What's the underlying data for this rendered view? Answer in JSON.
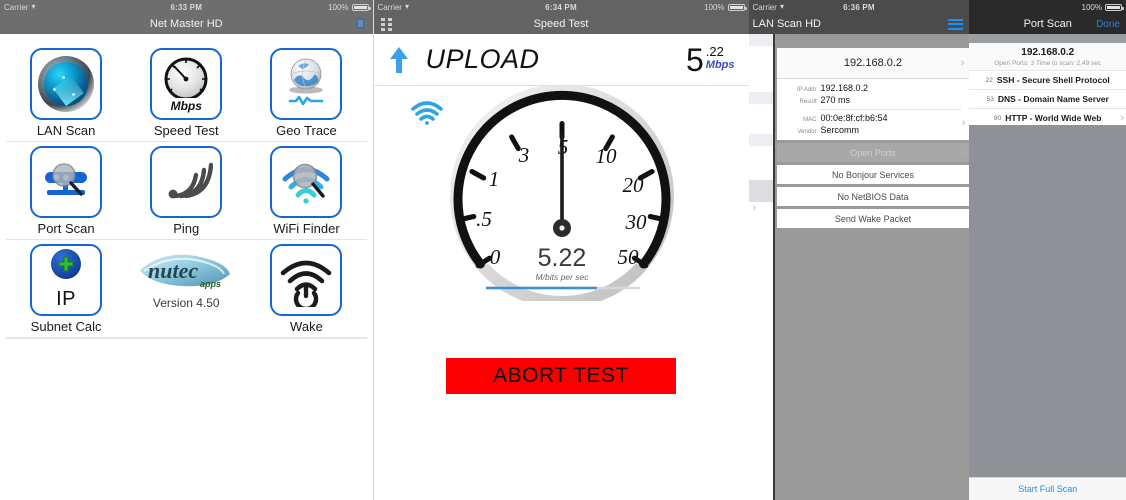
{
  "panels": {
    "net_master": {
      "status": {
        "carrier": "Carrier",
        "wifi_icon": "wifi-icon",
        "time": "6:33 PM",
        "battery_pct": "100%"
      },
      "nav": {
        "title": "Net Master HD",
        "right_icon": "info-icon"
      },
      "rows": [
        [
          {
            "label": "LAN Scan",
            "icon": "radar-orb-icon"
          },
          {
            "label": "Speed Test",
            "icon": "speedometer-icon",
            "inner_text": "Mbps"
          },
          {
            "label": "Geo Trace",
            "icon": "globe-trace-icon"
          }
        ],
        [
          {
            "label": "Port Scan",
            "icon": "magnifier-server-icon"
          },
          {
            "label": "Ping",
            "icon": "ping-waves-icon"
          },
          {
            "label": "WiFi Finder",
            "icon": "wifi-magnifier-icon"
          }
        ],
        [
          {
            "label": "Subnet Calc",
            "icon": "ip-plus-icon",
            "inner_text": "IP"
          },
          {
            "label": "",
            "icon": "nutec-apps-logo",
            "version": "Version 4.50"
          },
          {
            "label": "Wake",
            "icon": "wifi-power-icon"
          }
        ]
      ]
    },
    "speed_test": {
      "status": {
        "carrier": "Carrier",
        "wifi_icon": "wifi-icon",
        "time": "6:34 PM",
        "battery_pct": "100%"
      },
      "nav": {
        "title": "Speed Test",
        "left_icon": "grid-apps-icon"
      },
      "direction": {
        "label": "UPLOAD",
        "icon": "up-arrow-icon"
      },
      "reading": {
        "whole": "5",
        "decimal": ".22",
        "unit": "Mbps"
      },
      "gauge": {
        "center_value": "5.22",
        "center_unit": "M/bits per sec",
        "wifi_icon": "wifi-signal-icon"
      },
      "abort_label": "ABORT TEST",
      "accent": "#fb0000"
    },
    "lan_scan": {
      "status": {
        "carrier": "Carrier",
        "wifi_icon": "wifi-icon",
        "time": "6:36 PM"
      },
      "nav": {
        "title": "LAN Scan HD",
        "right_icon": "list-hamburger-icon"
      },
      "host": "192.168.0.2",
      "details": [
        {
          "key": "IP Addr",
          "value": "192.168.0.2"
        },
        {
          "key": "Result",
          "value": "270 ms"
        },
        {
          "key": "MAC",
          "value": "00:0e:8f:cf:b6:54"
        },
        {
          "key": "Vendor",
          "value": "Sercomm"
        }
      ],
      "actions": [
        {
          "label": "Open Ports",
          "selected": true
        },
        {
          "label": "No Bonjour Services",
          "selected": false
        },
        {
          "label": "No NetBIOS Data",
          "selected": false
        },
        {
          "label": "Send Wake Packet",
          "selected": false
        }
      ]
    },
    "port_scan": {
      "status": {
        "battery_pct": "100%"
      },
      "nav": {
        "title": "Port Scan",
        "done_label": "Done"
      },
      "host": "192.168.0.2",
      "summary": "Open Ports: 3  Time to scan: 2.49 sec",
      "ports": [
        {
          "port": "22",
          "name": "SSH - Secure Shell Protocol"
        },
        {
          "port": "53",
          "name": "DNS - Domain Name Server"
        },
        {
          "port": "80",
          "name": "HTTP - World Wide Web"
        }
      ],
      "footer_label": "Start Full Scan",
      "accent": "#1e8ff0"
    }
  },
  "chart_data": {
    "type": "gauge",
    "title": "Upload speed",
    "value": 5.22,
    "unit": "M/bits per sec",
    "ticks": [
      0,
      0.5,
      1,
      3,
      5,
      10,
      20,
      30,
      50
    ],
    "tick_labels": [
      "0",
      ".5",
      "1",
      "3",
      "5",
      "10",
      "20",
      "30",
      "50"
    ],
    "needle_at": 5,
    "progress_pct": 72
  }
}
